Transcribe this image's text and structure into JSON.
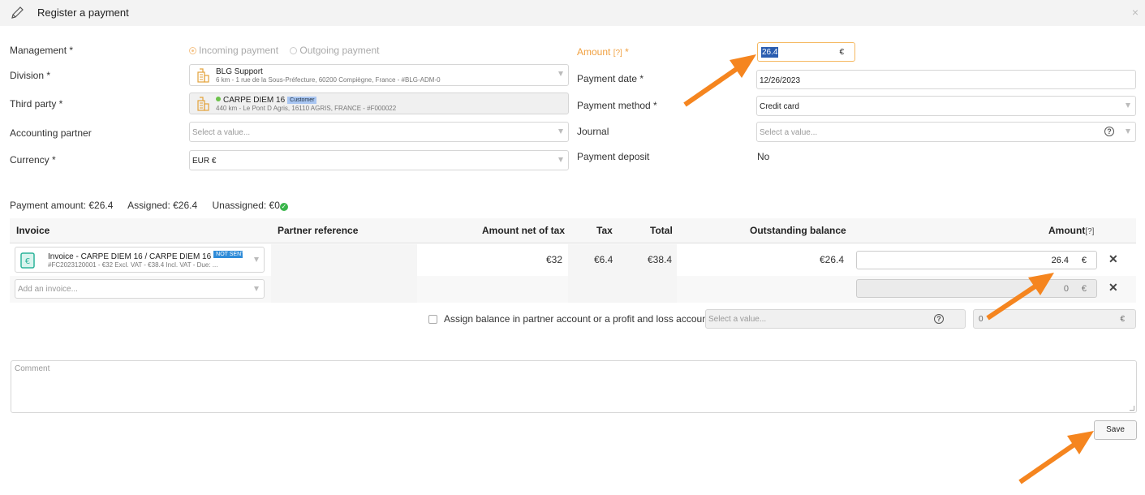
{
  "header": {
    "title": "Register a payment",
    "close_icon": "×"
  },
  "form_left": {
    "management": {
      "label": "Management *",
      "options": [
        "Incoming payment",
        "Outgoing payment"
      ],
      "selected": "Incoming payment"
    },
    "division": {
      "label": "Division *",
      "name": "BLG Support",
      "detail": "6 km - 1 rue de la Sous-Préfecture, 60200 Compiègne, France - #BLG-ADM-0"
    },
    "third_party": {
      "label": "Third party *",
      "name": "CARPE DIEM 16",
      "badge": "Customer",
      "detail": "440 km - Le Pont D Agris, 16110 AGRIS, FRANCE - #F000022"
    },
    "accounting_partner": {
      "label": "Accounting partner",
      "placeholder": "Select a value..."
    },
    "currency": {
      "label": "Currency *",
      "value": "EUR €"
    }
  },
  "form_right": {
    "amount": {
      "label": "Amount",
      "help": "[?]",
      "required": "*",
      "value": "26.4",
      "currency": "€"
    },
    "payment_date": {
      "label": "Payment date *",
      "value": "12/26/2023"
    },
    "payment_method": {
      "label": "Payment method *",
      "value": "Credit card"
    },
    "journal": {
      "label": "Journal",
      "placeholder": "Select a value..."
    },
    "payment_deposit": {
      "label": "Payment deposit",
      "value": "No"
    }
  },
  "summary": {
    "payment_amount": "Payment amount: €26.4",
    "assigned": "Assigned: €26.4",
    "unassigned": "Unassigned: €0"
  },
  "table": {
    "headers": {
      "invoice": "Invoice",
      "partner_reference": "Partner reference",
      "amount_net": "Amount net of tax",
      "tax": "Tax",
      "total": "Total",
      "outstanding": "Outstanding balance",
      "amount": "Amount",
      "amount_help": "[?]"
    },
    "rows": [
      {
        "invoice_title": "Invoice - CARPE DIEM 16 / CARPE DIEM 16",
        "badge": "NOT SENT",
        "invoice_detail": "#FC2023120001 - €32 Excl. VAT - €38.4 Incl. VAT - Due: ...",
        "amount_net": "€32",
        "tax": "€6.4",
        "total": "€38.4",
        "outstanding": "€26.4",
        "amount": "26.4",
        "currency": "€"
      }
    ],
    "add_row": {
      "placeholder": "Add an invoice...",
      "amount": "0",
      "currency": "€"
    }
  },
  "balance": {
    "label": "Assign balance in partner account or a profit and loss account",
    "placeholder": "Select a value...",
    "amount": "0",
    "currency": "€"
  },
  "comment": {
    "placeholder": "Comment"
  },
  "actions": {
    "save": "Save"
  },
  "colors": {
    "accent_orange": "#f0a040",
    "arrow_orange": "#f5851f",
    "selection_blue": "#2a5db0",
    "badge_blue": "#2e8bd8"
  }
}
